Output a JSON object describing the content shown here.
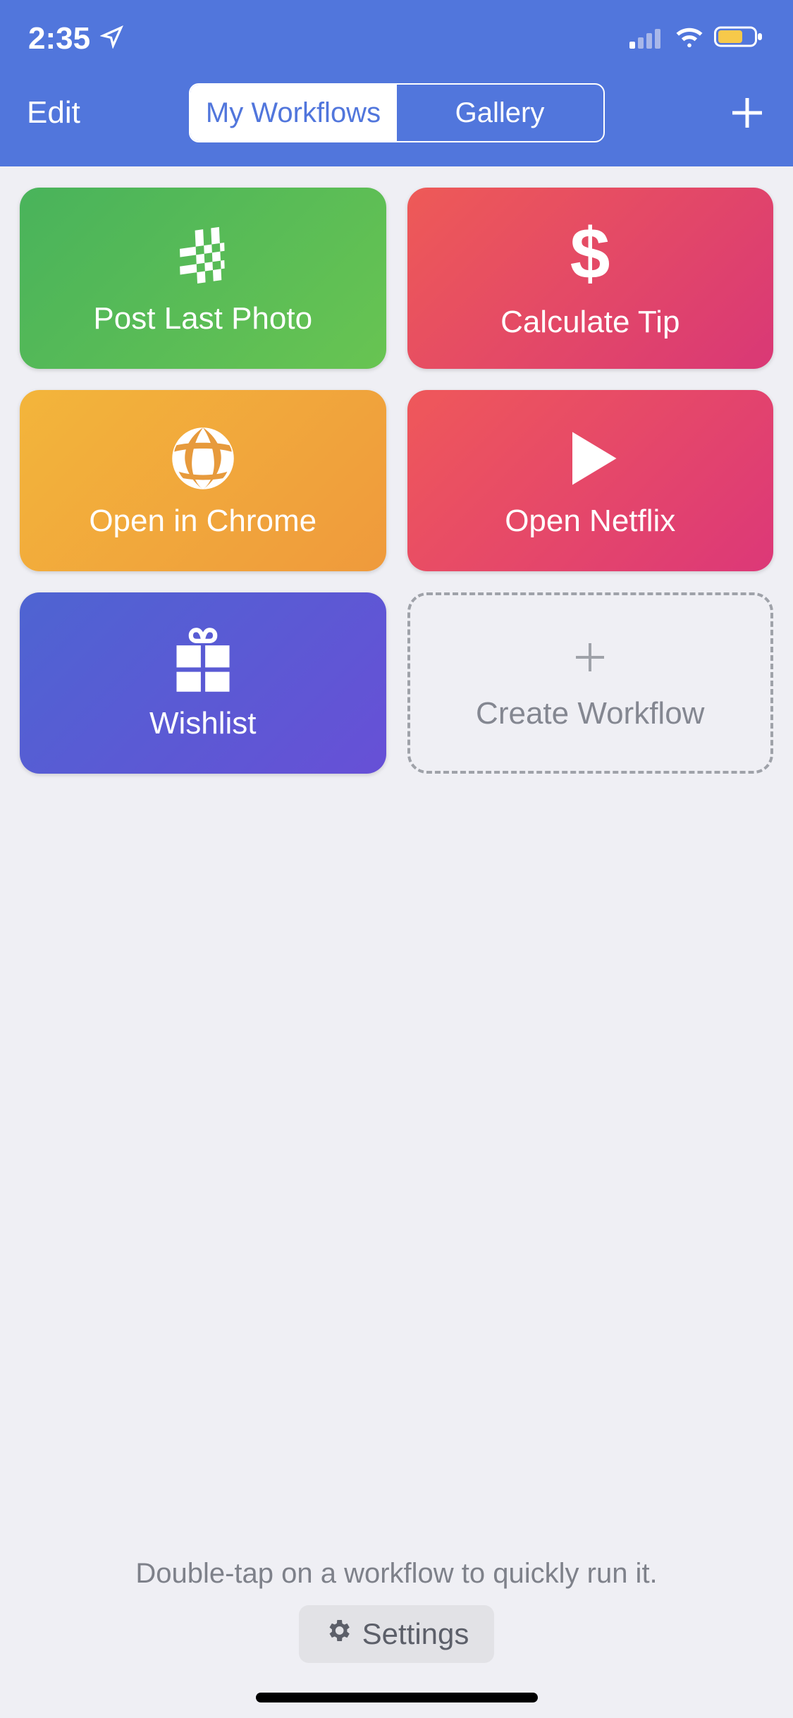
{
  "statusBar": {
    "time": "2:35"
  },
  "nav": {
    "edit": "Edit",
    "segments": {
      "my": "My Workflows",
      "gallery": "Gallery"
    }
  },
  "workflows": [
    {
      "label": "Post Last Photo",
      "icon": "hash-icon"
    },
    {
      "label": "Calculate Tip",
      "icon": "dollar-icon"
    },
    {
      "label": "Open in Chrome",
      "icon": "globe-icon"
    },
    {
      "label": "Open Netflix",
      "icon": "play-icon"
    },
    {
      "label": "Wishlist",
      "icon": "gift-icon"
    }
  ],
  "create": {
    "label": "Create Workflow"
  },
  "footer": {
    "hint": "Double-tap on a workflow to quickly run it.",
    "settings": "Settings"
  }
}
